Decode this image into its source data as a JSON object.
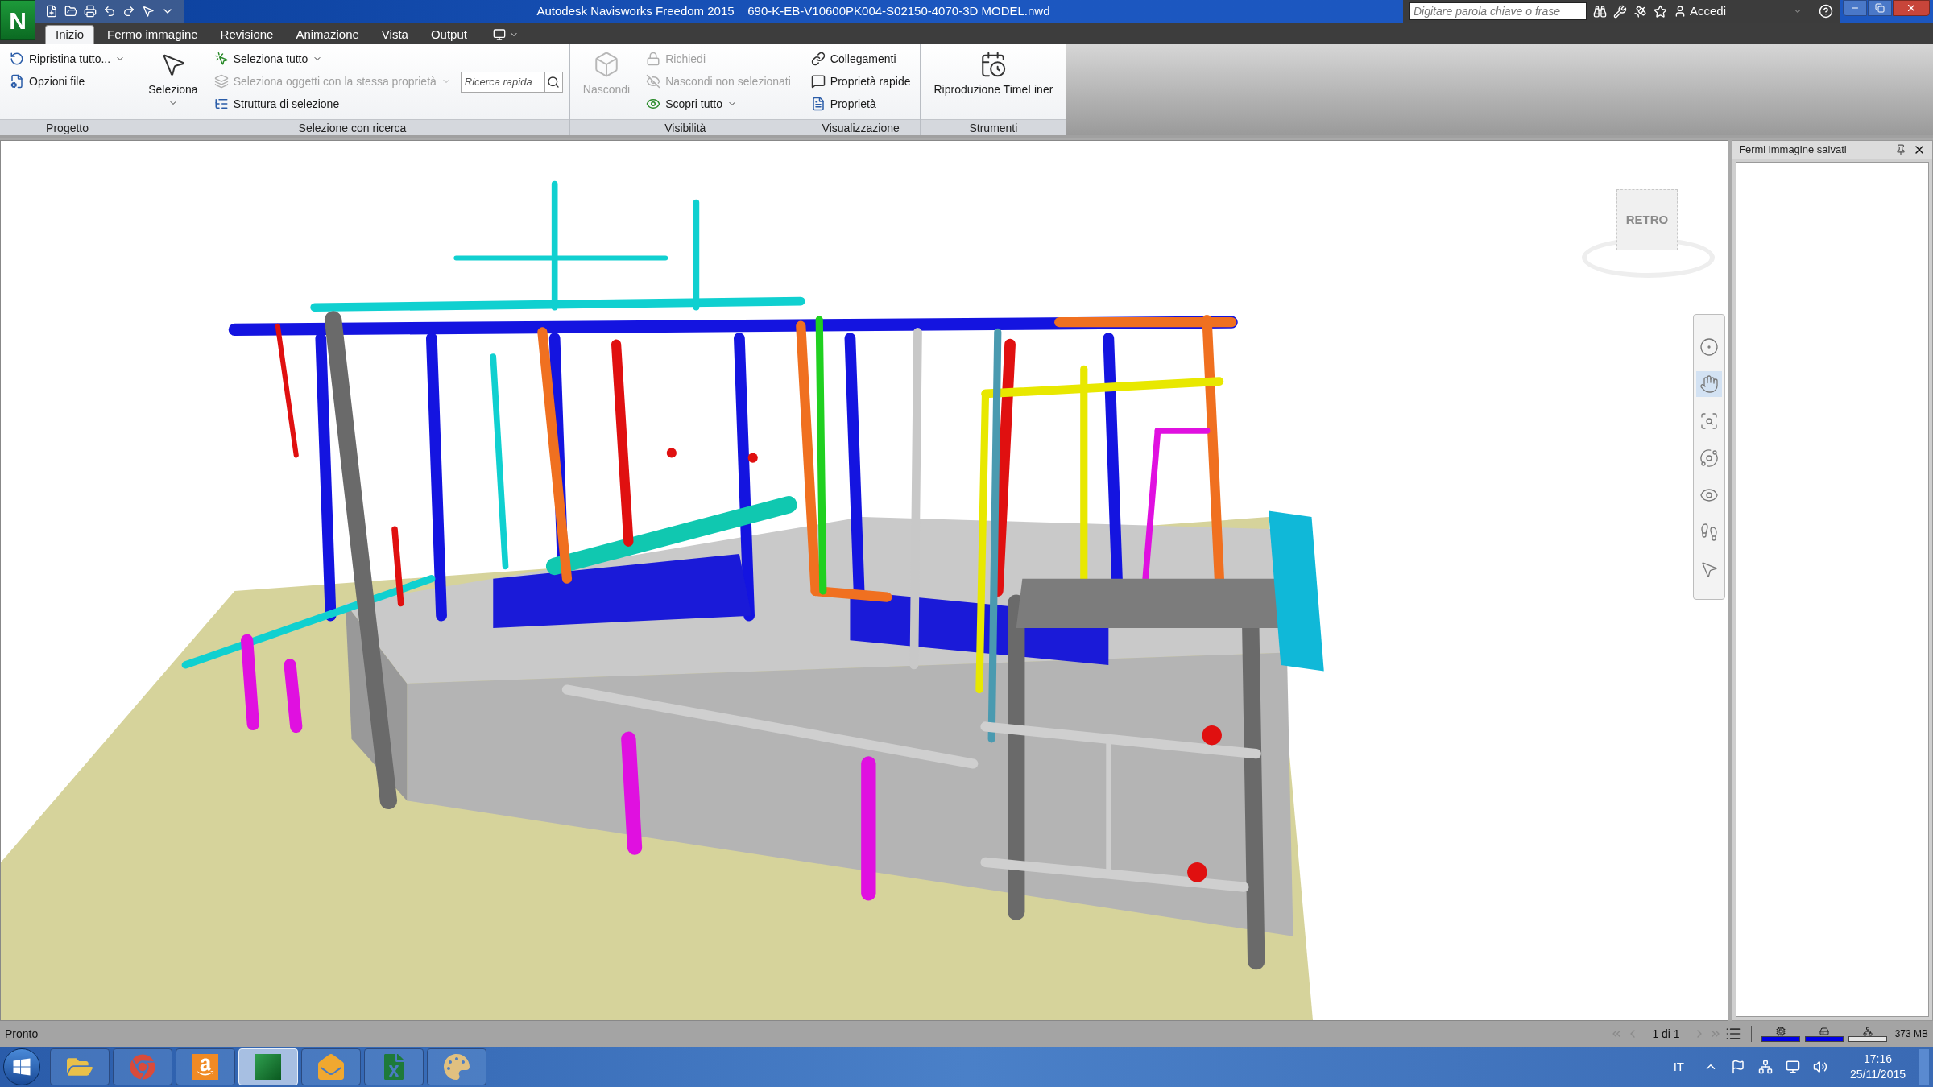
{
  "app_logo": "N",
  "title": {
    "app": "Autodesk Navisworks Freedom 2015",
    "file": "690-K-EB-V10600PK004-S02150-4070-3D MODEL.nwd"
  },
  "help_search": {
    "placeholder": "Digitare parola chiave o frase"
  },
  "sign_in": "Accedi",
  "tabs": [
    {
      "label": "Inizio",
      "selected": true
    },
    {
      "label": "Fermo immagine",
      "selected": false
    },
    {
      "label": "Revisione",
      "selected": false
    },
    {
      "label": "Animazione",
      "selected": false
    },
    {
      "label": "Vista",
      "selected": false
    },
    {
      "label": "Output",
      "selected": false
    }
  ],
  "ribbon_panels": [
    {
      "title": "Progetto",
      "items": [
        {
          "kind": "small",
          "label": "Ripristina tutto...",
          "dropdown": true,
          "disabled": false
        },
        {
          "kind": "small",
          "label": "Opzioni file",
          "dropdown": false,
          "disabled": false
        }
      ]
    },
    {
      "title": "Selezione con ricerca",
      "items": [
        {
          "kind": "large",
          "label": "Seleziona",
          "dropdown": true,
          "disabled": false
        },
        {
          "kind": "small",
          "label": "Seleziona tutto",
          "dropdown": true,
          "disabled": false
        },
        {
          "kind": "small",
          "label": "Seleziona oggetti con la stessa proprietà",
          "dropdown": true,
          "disabled": true
        },
        {
          "kind": "small",
          "label": "Struttura di selezione",
          "dropdown": false,
          "disabled": false
        },
        {
          "kind": "search",
          "placeholder": "Ricerca rapida"
        }
      ]
    },
    {
      "title": "Visibilità",
      "items": [
        {
          "kind": "large",
          "label": "Nascondi",
          "dropdown": false,
          "disabled": true
        },
        {
          "kind": "small",
          "label": "Richiedi",
          "dropdown": false,
          "disabled": true
        },
        {
          "kind": "small",
          "label": "Nascondi non selezionati",
          "dropdown": false,
          "disabled": true
        },
        {
          "kind": "small",
          "label": "Scopri tutto",
          "dropdown": true,
          "disabled": false
        }
      ]
    },
    {
      "title": "Visualizzazione",
      "items": [
        {
          "kind": "small",
          "label": "Collegamenti",
          "dropdown": false,
          "disabled": false
        },
        {
          "kind": "small",
          "label": "Proprietà rapide",
          "dropdown": false,
          "disabled": false
        },
        {
          "kind": "small",
          "label": "Proprietà",
          "dropdown": false,
          "disabled": false
        }
      ]
    },
    {
      "title": "Strumenti",
      "items": [
        {
          "kind": "large",
          "label": "Riproduzione TimeLiner",
          "dropdown": false,
          "disabled": false
        }
      ]
    }
  ],
  "view_cube": {
    "face": "RETRO"
  },
  "nav_tools": [
    {
      "selected": false
    },
    {
      "selected": true
    },
    {
      "selected": false
    },
    {
      "selected": false
    },
    {
      "selected": false
    },
    {
      "selected": false
    },
    {
      "selected": false
    }
  ],
  "side_panel": {
    "title": "Fermi immagine salvati"
  },
  "status_bar": {
    "text": "Pronto",
    "page": "1 di 1",
    "memory": "373 MB",
    "meters": [
      {
        "level": 1
      },
      {
        "level": 1
      },
      {
        "level": 0
      }
    ]
  },
  "taskbar": {
    "apps": [
      {
        "selected": false
      },
      {
        "selected": false
      },
      {
        "selected": false
      },
      {
        "selected": true
      },
      {
        "selected": false
      },
      {
        "selected": false
      },
      {
        "selected": false
      }
    ],
    "language": "IT",
    "time": "17:16",
    "date": "25/11/2015"
  }
}
